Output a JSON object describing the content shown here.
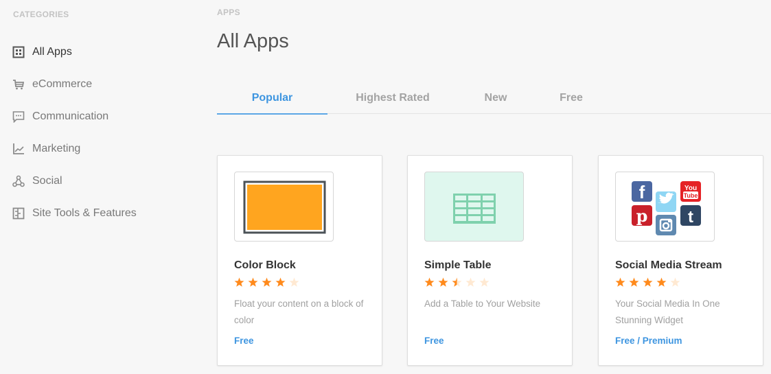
{
  "sidebar": {
    "heading": "CATEGORIES",
    "items": [
      {
        "label": "All Apps",
        "icon": "grid-icon",
        "active": true
      },
      {
        "label": "eCommerce",
        "icon": "cart-icon",
        "active": false
      },
      {
        "label": "Communication",
        "icon": "chat-icon",
        "active": false
      },
      {
        "label": "Marketing",
        "icon": "line-chart-icon",
        "active": false
      },
      {
        "label": "Social",
        "icon": "share-nodes-icon",
        "active": false
      },
      {
        "label": "Site Tools & Features",
        "icon": "tools-icon",
        "active": false
      }
    ]
  },
  "main": {
    "breadcrumb": "APPS",
    "title": "All Apps",
    "tabs": [
      {
        "label": "Popular",
        "active": true
      },
      {
        "label": "Highest Rated",
        "active": false
      },
      {
        "label": "New",
        "active": false
      },
      {
        "label": "Free",
        "active": false
      }
    ],
    "apps": [
      {
        "name": "Color Block",
        "rating": 4,
        "max_rating": 5,
        "description": "Float your content on a block of color",
        "price": "Free",
        "thumbnail": "color-block-thumbnail"
      },
      {
        "name": "Simple Table",
        "rating": 2.5,
        "max_rating": 5,
        "description": "Add a Table to Your Website",
        "price": "Free",
        "thumbnail": "table-thumbnail"
      },
      {
        "name": "Social Media Stream",
        "rating": 4,
        "max_rating": 5,
        "description": "Your Social Media In One Stunning Widget",
        "price": "Free / Premium",
        "thumbnail": "social-icons-thumbnail"
      }
    ]
  },
  "colors": {
    "accent": "#3d95e0",
    "star_filled": "#ff8a1c",
    "star_empty": "#ffe9d2",
    "color_block_fill": "#ffa51f",
    "table_green": "#7fd1ad",
    "table_bg": "#dff7ee"
  }
}
